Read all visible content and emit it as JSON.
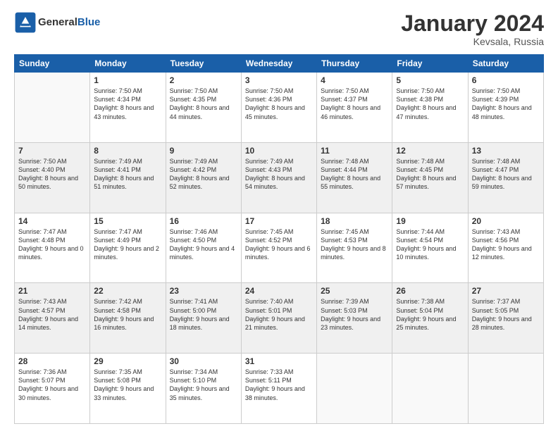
{
  "header": {
    "logo_line1": "General",
    "logo_line2": "Blue",
    "month": "January 2024",
    "location": "Kevsala, Russia"
  },
  "weekdays": [
    "Sunday",
    "Monday",
    "Tuesday",
    "Wednesday",
    "Thursday",
    "Friday",
    "Saturday"
  ],
  "weeks": [
    [
      {
        "day": "",
        "sunrise": "",
        "sunset": "",
        "daylight": ""
      },
      {
        "day": "1",
        "sunrise": "Sunrise: 7:50 AM",
        "sunset": "Sunset: 4:34 PM",
        "daylight": "Daylight: 8 hours and 43 minutes."
      },
      {
        "day": "2",
        "sunrise": "Sunrise: 7:50 AM",
        "sunset": "Sunset: 4:35 PM",
        "daylight": "Daylight: 8 hours and 44 minutes."
      },
      {
        "day": "3",
        "sunrise": "Sunrise: 7:50 AM",
        "sunset": "Sunset: 4:36 PM",
        "daylight": "Daylight: 8 hours and 45 minutes."
      },
      {
        "day": "4",
        "sunrise": "Sunrise: 7:50 AM",
        "sunset": "Sunset: 4:37 PM",
        "daylight": "Daylight: 8 hours and 46 minutes."
      },
      {
        "day": "5",
        "sunrise": "Sunrise: 7:50 AM",
        "sunset": "Sunset: 4:38 PM",
        "daylight": "Daylight: 8 hours and 47 minutes."
      },
      {
        "day": "6",
        "sunrise": "Sunrise: 7:50 AM",
        "sunset": "Sunset: 4:39 PM",
        "daylight": "Daylight: 8 hours and 48 minutes."
      }
    ],
    [
      {
        "day": "7",
        "sunrise": "Sunrise: 7:50 AM",
        "sunset": "Sunset: 4:40 PM",
        "daylight": "Daylight: 8 hours and 50 minutes."
      },
      {
        "day": "8",
        "sunrise": "Sunrise: 7:49 AM",
        "sunset": "Sunset: 4:41 PM",
        "daylight": "Daylight: 8 hours and 51 minutes."
      },
      {
        "day": "9",
        "sunrise": "Sunrise: 7:49 AM",
        "sunset": "Sunset: 4:42 PM",
        "daylight": "Daylight: 8 hours and 52 minutes."
      },
      {
        "day": "10",
        "sunrise": "Sunrise: 7:49 AM",
        "sunset": "Sunset: 4:43 PM",
        "daylight": "Daylight: 8 hours and 54 minutes."
      },
      {
        "day": "11",
        "sunrise": "Sunrise: 7:48 AM",
        "sunset": "Sunset: 4:44 PM",
        "daylight": "Daylight: 8 hours and 55 minutes."
      },
      {
        "day": "12",
        "sunrise": "Sunrise: 7:48 AM",
        "sunset": "Sunset: 4:45 PM",
        "daylight": "Daylight: 8 hours and 57 minutes."
      },
      {
        "day": "13",
        "sunrise": "Sunrise: 7:48 AM",
        "sunset": "Sunset: 4:47 PM",
        "daylight": "Daylight: 8 hours and 59 minutes."
      }
    ],
    [
      {
        "day": "14",
        "sunrise": "Sunrise: 7:47 AM",
        "sunset": "Sunset: 4:48 PM",
        "daylight": "Daylight: 9 hours and 0 minutes."
      },
      {
        "day": "15",
        "sunrise": "Sunrise: 7:47 AM",
        "sunset": "Sunset: 4:49 PM",
        "daylight": "Daylight: 9 hours and 2 minutes."
      },
      {
        "day": "16",
        "sunrise": "Sunrise: 7:46 AM",
        "sunset": "Sunset: 4:50 PM",
        "daylight": "Daylight: 9 hours and 4 minutes."
      },
      {
        "day": "17",
        "sunrise": "Sunrise: 7:45 AM",
        "sunset": "Sunset: 4:52 PM",
        "daylight": "Daylight: 9 hours and 6 minutes."
      },
      {
        "day": "18",
        "sunrise": "Sunrise: 7:45 AM",
        "sunset": "Sunset: 4:53 PM",
        "daylight": "Daylight: 9 hours and 8 minutes."
      },
      {
        "day": "19",
        "sunrise": "Sunrise: 7:44 AM",
        "sunset": "Sunset: 4:54 PM",
        "daylight": "Daylight: 9 hours and 10 minutes."
      },
      {
        "day": "20",
        "sunrise": "Sunrise: 7:43 AM",
        "sunset": "Sunset: 4:56 PM",
        "daylight": "Daylight: 9 hours and 12 minutes."
      }
    ],
    [
      {
        "day": "21",
        "sunrise": "Sunrise: 7:43 AM",
        "sunset": "Sunset: 4:57 PM",
        "daylight": "Daylight: 9 hours and 14 minutes."
      },
      {
        "day": "22",
        "sunrise": "Sunrise: 7:42 AM",
        "sunset": "Sunset: 4:58 PM",
        "daylight": "Daylight: 9 hours and 16 minutes."
      },
      {
        "day": "23",
        "sunrise": "Sunrise: 7:41 AM",
        "sunset": "Sunset: 5:00 PM",
        "daylight": "Daylight: 9 hours and 18 minutes."
      },
      {
        "day": "24",
        "sunrise": "Sunrise: 7:40 AM",
        "sunset": "Sunset: 5:01 PM",
        "daylight": "Daylight: 9 hours and 21 minutes."
      },
      {
        "day": "25",
        "sunrise": "Sunrise: 7:39 AM",
        "sunset": "Sunset: 5:03 PM",
        "daylight": "Daylight: 9 hours and 23 minutes."
      },
      {
        "day": "26",
        "sunrise": "Sunrise: 7:38 AM",
        "sunset": "Sunset: 5:04 PM",
        "daylight": "Daylight: 9 hours and 25 minutes."
      },
      {
        "day": "27",
        "sunrise": "Sunrise: 7:37 AM",
        "sunset": "Sunset: 5:05 PM",
        "daylight": "Daylight: 9 hours and 28 minutes."
      }
    ],
    [
      {
        "day": "28",
        "sunrise": "Sunrise: 7:36 AM",
        "sunset": "Sunset: 5:07 PM",
        "daylight": "Daylight: 9 hours and 30 minutes."
      },
      {
        "day": "29",
        "sunrise": "Sunrise: 7:35 AM",
        "sunset": "Sunset: 5:08 PM",
        "daylight": "Daylight: 9 hours and 33 minutes."
      },
      {
        "day": "30",
        "sunrise": "Sunrise: 7:34 AM",
        "sunset": "Sunset: 5:10 PM",
        "daylight": "Daylight: 9 hours and 35 minutes."
      },
      {
        "day": "31",
        "sunrise": "Sunrise: 7:33 AM",
        "sunset": "Sunset: 5:11 PM",
        "daylight": "Daylight: 9 hours and 38 minutes."
      },
      {
        "day": "",
        "sunrise": "",
        "sunset": "",
        "daylight": ""
      },
      {
        "day": "",
        "sunrise": "",
        "sunset": "",
        "daylight": ""
      },
      {
        "day": "",
        "sunrise": "",
        "sunset": "",
        "daylight": ""
      }
    ]
  ]
}
